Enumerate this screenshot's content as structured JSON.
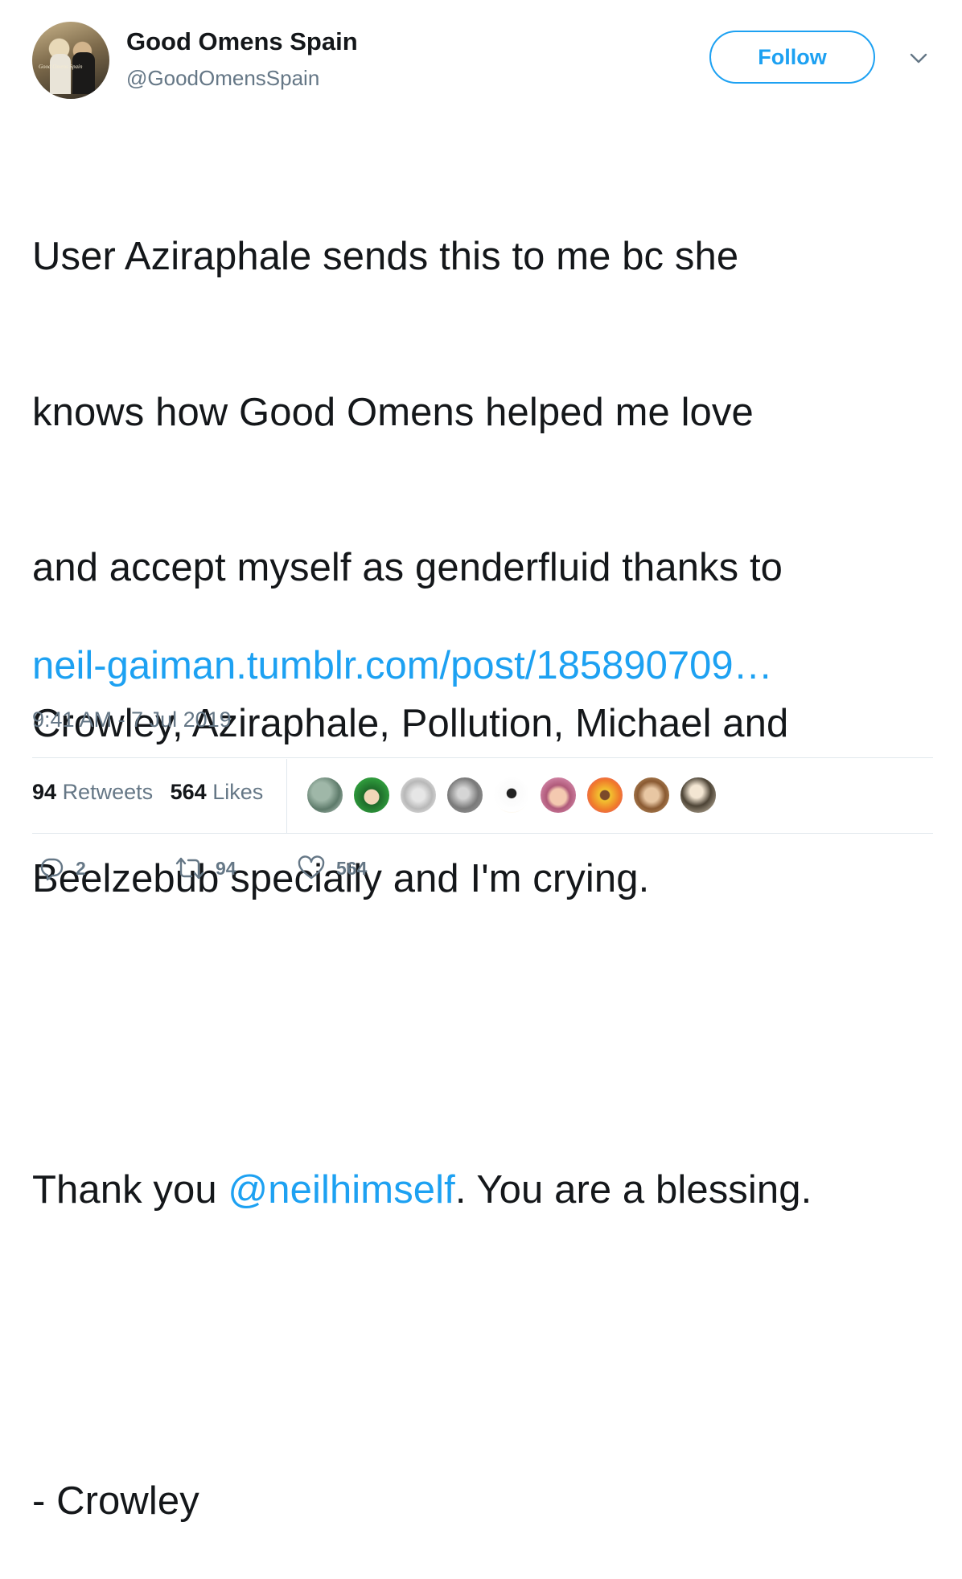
{
  "user": {
    "name": "Good Omens Spain",
    "handle": "@GoodOmensSpain",
    "avatar_caption": "Good Omens Spain"
  },
  "follow_label": "Follow",
  "tweet": {
    "line1": "User Aziraphale sends this to me bc she",
    "line2": "knows how Good Omens helped me love",
    "line3": "and accept myself as genderfluid thanks to",
    "line4": "Crowley, Aziraphale, Pollution, Michael and",
    "line5": "Beelzebub specially and I'm crying.",
    "thanks_prefix": "Thank you ",
    "mention": "@neilhimself",
    "thanks_suffix": ". You are a blessing.",
    "signature": "- Crowley",
    "link": "neil-gaiman.tumblr.com/post/185890709…"
  },
  "timestamp": "9:41 AM - 7 Jul 2019",
  "stats": {
    "retweets_count": "94",
    "retweets_label": "Retweets",
    "likes_count": "564",
    "likes_label": "Likes"
  },
  "actions": {
    "reply_count": "2",
    "retweet_count": "94",
    "like_count": "564"
  },
  "colors": {
    "accent": "#1da1f2",
    "text": "#14171a",
    "muted": "#657786",
    "divider": "#e1e8ed"
  }
}
